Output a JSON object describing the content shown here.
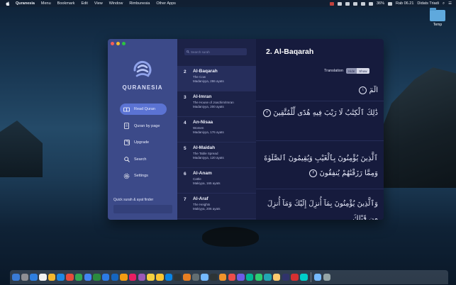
{
  "menubar": {
    "app_name": "Quranesia",
    "items": [
      "Menu",
      "Bookmark",
      "Edit",
      "View",
      "Window",
      "Rimbunesia",
      "Other Apps"
    ],
    "battery": "36%",
    "clock": "Rab 06.21",
    "user": "Didats Triadi"
  },
  "desktop": {
    "folder_label": "Temp"
  },
  "sidebar": {
    "brand": "QURANESIA",
    "nav": [
      {
        "label": "Read Quran",
        "icon": "book-icon",
        "active": true
      },
      {
        "label": "Quran by page",
        "icon": "page-icon",
        "active": false
      },
      {
        "label": "Upgrade",
        "icon": "upgrade-icon",
        "active": false
      },
      {
        "label": "Search",
        "icon": "search-icon",
        "active": false
      },
      {
        "label": "Settings",
        "icon": "gear-icon",
        "active": false
      }
    ],
    "finder_label": "Quick surah & ayat finder",
    "finder_placeholder": ""
  },
  "list": {
    "search_placeholder": "Search surah",
    "surahs": [
      {
        "num": "2",
        "name": "Al-Baqarah",
        "translation": "The Cow",
        "meta": "Madaniyya, 286 ayats"
      },
      {
        "num": "3",
        "name": "Al-Imran",
        "translation": "The House of Joachim/Imran",
        "meta": "Madaniyya, 200 ayats"
      },
      {
        "num": "4",
        "name": "An-Nisaa",
        "translation": "Women",
        "meta": "Madaniyya, 176 ayats"
      },
      {
        "num": "5",
        "name": "Al-Maidah",
        "translation": "The Table Spread",
        "meta": "Madaniyya, 120 ayats"
      },
      {
        "num": "6",
        "name": "Al-Anam",
        "translation": "Cattle",
        "meta": "Makiyya, 165 ayats"
      },
      {
        "num": "7",
        "name": "Al-Araf",
        "translation": "The Heights",
        "meta": "Makiyya, 206 ayats"
      }
    ]
  },
  "reader": {
    "title": "2. Al-Baqarah",
    "translation_label": "Translation",
    "hide_label": "Hide",
    "show_label": "Show",
    "ayahs": [
      {
        "text": "الٓمٓ",
        "num": "١"
      },
      {
        "text": "ذَٰلِكَ ٱلْكِتَٰبُ لَا رَيْبَ فِيهِ هُدًى لِّلْمُتَّقِينَ",
        "num": "٢"
      },
      {
        "text": "ٱلَّذِينَ يُؤْمِنُونَ بِٱلْغَيْبِ وَيُقِيمُونَ ٱلصَّلَوٰةَ وَمِمَّا رَزَقْنَٰهُمْ يُنفِقُونَ",
        "num": "٣"
      },
      {
        "text": "وَٱلَّذِينَ يُؤْمِنُونَ بِمَآ أُنزِلَ إِلَيْكَ وَمَآ أُنزِلَ مِن قَبْلِكَ",
        "num": ""
      }
    ]
  },
  "dock": {
    "colors": [
      "#3a7bd5",
      "#8e8e93",
      "#2f7fe0",
      "#f2f2f2",
      "#f5b82e",
      "#1e88e5",
      "#e74c3c",
      "#34a853",
      "#4285f4",
      "#2b8a3e",
      "#2c7be5",
      "#1565c0",
      "#f39c12",
      "#e91e63",
      "#9b59b6",
      "#f4d03f",
      "#fbc531",
      "#0984e3",
      "#2d3436",
      "#e67e22",
      "#636e72",
      "#74b9ff",
      "#2d3436",
      "#f0932b",
      "#eb4d4b",
      "#6c5ce7",
      "#00b894",
      "#2ecc71",
      "#22a6b3",
      "#fdcb6e",
      "#30336b",
      "#d63031",
      "#00cec9",
      "#74b9ff",
      "#95a5a6"
    ]
  }
}
